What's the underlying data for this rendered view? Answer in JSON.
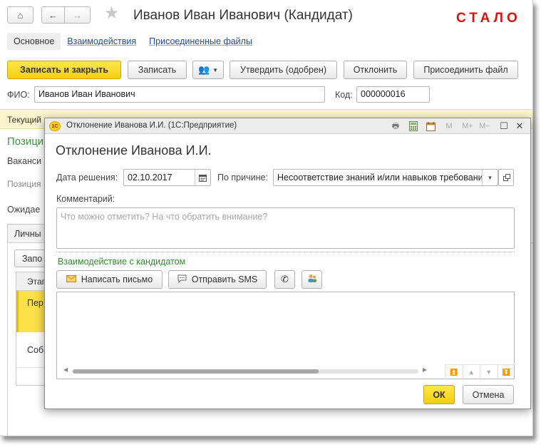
{
  "main": {
    "title": "Иванов Иван Иванович (Кандидат)",
    "watermark": "СТАЛО",
    "tabs": [
      {
        "label": "Основное"
      },
      {
        "label": "Взаимодействия"
      },
      {
        "label": "Присоединенные файлы"
      }
    ],
    "toolbar": {
      "save_close": "Записать и закрыть",
      "save": "Записать",
      "approve": "Утвердить (одобрен)",
      "reject": "Отклонить",
      "attach": "Присоединить файл"
    },
    "fio_label": "ФИО:",
    "fio_value": "Иванов Иван Иванович",
    "code_label": "Код:",
    "code_value": "000000016",
    "band_text": "Текущий",
    "section_heading": "Позици",
    "vacancy_label": "Ваканси",
    "position_label": "Позиция",
    "expect_label": "Ожидае",
    "inner_tab": "Личны",
    "inner_button": "Запо",
    "grid_header": "Этап",
    "grid_rows": [
      "Пер",
      "Соб"
    ]
  },
  "dialog": {
    "window_title": "Отклонение Иванова И.И.  (1С:Предприятие)",
    "logo": "1С",
    "toolbar_icons": [
      "M",
      "M+",
      "M−"
    ],
    "title": "Отклонение Иванова И.И.",
    "date_label": "Дата решения:",
    "date_value": "02.10.2017",
    "reason_label": "По причине:",
    "reason_value": "Несоответствие знаний и/или навыков требовани",
    "comment_label": "Комментарий:",
    "comment_placeholder": "Что можно отметить? На что обратить внимание?",
    "interaction_heading": "Взаимодействие с кандидатом",
    "write_letter": "Написать письмо",
    "send_sms": "Отправить SMS",
    "ok": "ОК",
    "cancel": "Отмена"
  }
}
